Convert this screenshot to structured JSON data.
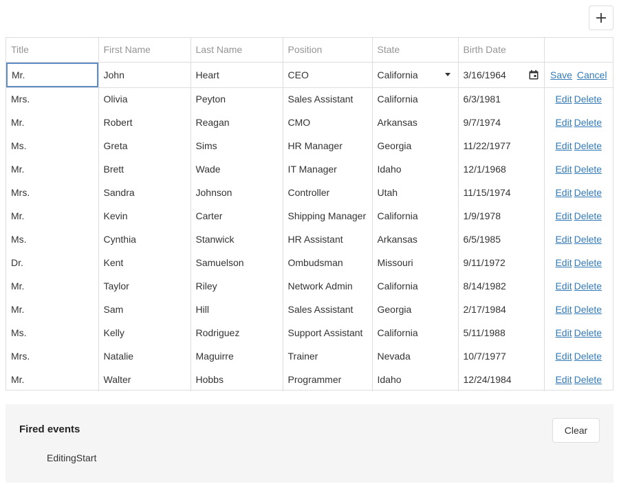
{
  "toolbar": {
    "add_icon": "plus-icon"
  },
  "grid": {
    "columns": [
      "Title",
      "First Name",
      "Last Name",
      "Position",
      "State",
      "Birth Date",
      ""
    ],
    "edit_row": {
      "title": "Mr.",
      "first_name": "John",
      "last_name": "Heart",
      "position": "CEO",
      "state": "California",
      "birth_date": "3/16/1964",
      "save_label": "Save",
      "cancel_label": "Cancel"
    },
    "edit_label": "Edit",
    "delete_label": "Delete",
    "rows": [
      [
        "Mrs.",
        "Olivia",
        "Peyton",
        "Sales Assistant",
        "California",
        "6/3/1981"
      ],
      [
        "Mr.",
        "Robert",
        "Reagan",
        "CMO",
        "Arkansas",
        "9/7/1974"
      ],
      [
        "Ms.",
        "Greta",
        "Sims",
        "HR Manager",
        "Georgia",
        "11/22/1977"
      ],
      [
        "Mr.",
        "Brett",
        "Wade",
        "IT Manager",
        "Idaho",
        "12/1/1968"
      ],
      [
        "Mrs.",
        "Sandra",
        "Johnson",
        "Controller",
        "Utah",
        "11/15/1974"
      ],
      [
        "Mr.",
        "Kevin",
        "Carter",
        "Shipping Manager",
        "California",
        "1/9/1978"
      ],
      [
        "Ms.",
        "Cynthia",
        "Stanwick",
        "HR Assistant",
        "Arkansas",
        "6/5/1985"
      ],
      [
        "Dr.",
        "Kent",
        "Samuelson",
        "Ombudsman",
        "Missouri",
        "9/11/1972"
      ],
      [
        "Mr.",
        "Taylor",
        "Riley",
        "Network Admin",
        "California",
        "8/14/1982"
      ],
      [
        "Mr.",
        "Sam",
        "Hill",
        "Sales Assistant",
        "Georgia",
        "2/17/1984"
      ],
      [
        "Ms.",
        "Kelly",
        "Rodriguez",
        "Support Assistant",
        "California",
        "5/11/1988"
      ],
      [
        "Mrs.",
        "Natalie",
        "Maguirre",
        "Trainer",
        "Nevada",
        "10/7/1977"
      ],
      [
        "Mr.",
        "Walter",
        "Hobbs",
        "Programmer",
        "Idaho",
        "12/24/1984"
      ]
    ]
  },
  "events": {
    "title": "Fired events",
    "clear_label": "Clear",
    "items": [
      "EditingStart"
    ]
  }
}
